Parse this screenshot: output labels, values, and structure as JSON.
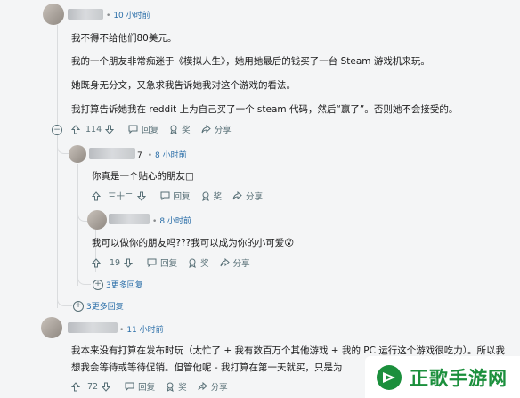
{
  "comments": [
    {
      "time": "10 小时前",
      "paragraphs": [
        "我不得不给他们80美元。",
        "我的一个朋友非常痴迷于《模拟人生》，她用她最后的钱买了一台 Steam 游戏机来玩。",
        "她既身无分文，又急求我告诉她我对这个游戏的看法。",
        "我打算告诉她我在 reddit 上为自己买了一个 steam 代码，然后“赢了”。否则她不会接受的。"
      ],
      "votes": "114",
      "reply": "回复",
      "award": "奖",
      "share": "分享"
    },
    {
      "name_tail": "7",
      "time": "8 小时前",
      "text": "你真是一个贴心的朋友□",
      "votes": "三十二",
      "reply": "回复",
      "award": "奖",
      "share": "分享"
    },
    {
      "time": "8 小时前",
      "text": "我可以做你的朋友吗???我可以成为你的小可爱😮",
      "votes": "19",
      "reply": "回复",
      "award": "奖",
      "share": "分享"
    },
    {
      "time": "11 小时前",
      "line1": "我本来没有打算在发布时玩（太忙了 + 我有数百万个其他游戏 + 我的 PC 运行这个游戏很吃力）。所以我",
      "line2": "想我会等待或等待促销。但管他呢 - 我打算在第一天就买，只是为",
      "votes": "72",
      "reply": "回复",
      "award": "奖",
      "share": "分享"
    }
  ],
  "more_replies": [
    "3更多回复",
    "3更多回复"
  ],
  "watermark": "正歌手游网",
  "colors": {
    "link": "#2a6ea8",
    "muted": "#576f76",
    "brand": "#1b8f3c"
  }
}
